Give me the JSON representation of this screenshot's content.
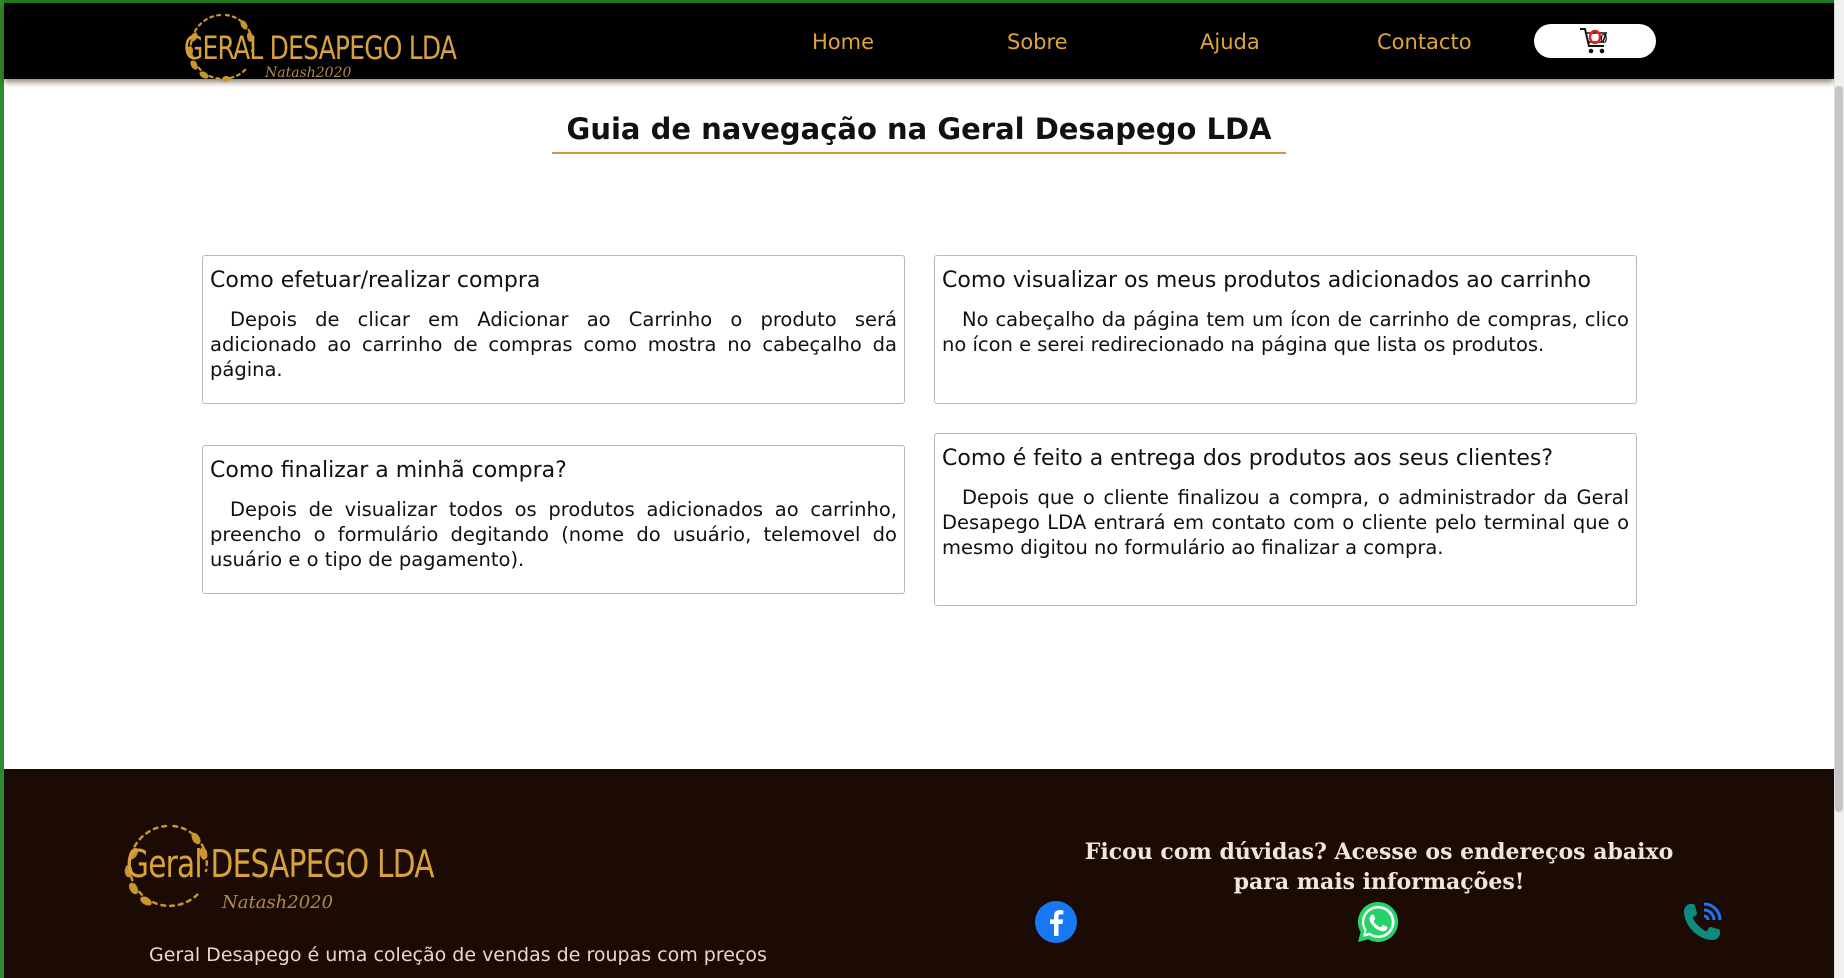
{
  "brand": {
    "name": "GERAL DESAPEGO LDA",
    "signature": "Natash2020"
  },
  "nav": {
    "items": [
      "Home",
      "Sobre",
      "Ajuda",
      "Contacto"
    ],
    "cart_count": "0"
  },
  "main": {
    "title": "Guia de navegação na Geral Desapego LDA",
    "cards": [
      {
        "title": "Como efetuar/realizar compra",
        "body": "Depois de clicar em Adicionar ao Carrinho o produto será adicionado ao carrinho de compras como mostra no cabeçalho da página."
      },
      {
        "title": "Como visualizar os meus produtos adicionados ao carrinho",
        "body": "No cabeçalho da página tem um ícon de carrinho de compras, clico no ícon e serei redirecionado na página que lista os produtos."
      },
      {
        "title": "Como finalizar a minhã compra?",
        "body": "Depois de visualizar todos os produtos adicionados ao carrinho, preencho o formulário degitando (nome do usuário, telemovel do usuário e o tipo de pagamento)."
      },
      {
        "title": "Como é feito a entrega dos produtos aos seus clientes?",
        "body": "Depois que o cliente finalizou a compra, o administrador da Geral Desapego LDA entrará em contato com o cliente pelo terminal que o mesmo digitou no formulário ao finalizar a compra."
      }
    ]
  },
  "footer": {
    "brand_name": "Geral DESAPEGO LDA",
    "signature": "Natash2020",
    "description": "Geral Desapego é uma coleção de vendas de roupas com preços",
    "cta": "Ficou com dúvidas? Acesse os endereços abaixo para mais informações!",
    "social_icons": [
      "facebook-icon",
      "whatsapp-icon",
      "phone-icon"
    ]
  },
  "colors": {
    "header_bg": "#000000",
    "accent_gold": "#e0a53a",
    "footer_bg": "#1c0b05",
    "facebook": "#1877f2",
    "whatsapp": "#25d366",
    "phone": "#0e8a7e"
  }
}
